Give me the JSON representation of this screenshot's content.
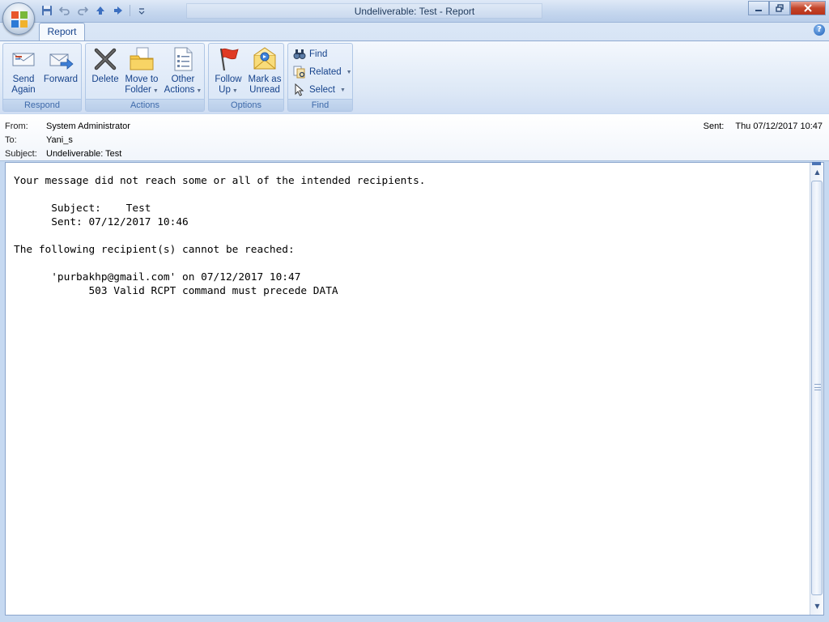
{
  "window": {
    "title": "Undeliverable: Test - Report"
  },
  "quick_access": {
    "icons": [
      "save-icon",
      "undo-icon",
      "redo-icon",
      "previous-item-icon",
      "next-item-icon",
      "customize-icon"
    ]
  },
  "ribbon": {
    "tab_label": "Report",
    "groups": {
      "respond": {
        "label": "Respond",
        "send_again": [
          "Send",
          "Again"
        ],
        "forward": [
          "Forward",
          ""
        ]
      },
      "actions": {
        "label": "Actions",
        "delete": [
          "Delete",
          ""
        ],
        "move_to_folder": [
          "Move to",
          "Folder"
        ],
        "other_actions": [
          "Other",
          "Actions"
        ]
      },
      "options": {
        "label": "Options",
        "follow_up": [
          "Follow",
          "Up"
        ],
        "mark_as_unread": [
          "Mark as",
          "Unread"
        ]
      },
      "find": {
        "label": "Find",
        "find": "Find",
        "related": "Related",
        "select": "Select"
      }
    }
  },
  "header": {
    "from_label": "From:",
    "from_value": "System Administrator",
    "to_label": "To:",
    "to_value": "Yani_s",
    "subject_label": "Subject:",
    "subject_value": "Undeliverable: Test",
    "sent_label": "Sent:",
    "sent_value": "Thu 07/12/2017 10:47"
  },
  "message": {
    "line1": "Your message did not reach some or all of the intended recipients.",
    "line2": "      Subject:    Test",
    "line3": "      Sent: 07/12/2017 10:46",
    "line4": "The following recipient(s) cannot be reached:",
    "line5": "      'purbakhp@gmail.com' on 07/12/2017 10:47",
    "line6": "            503 Valid RCPT command must precede DATA"
  },
  "colors": {
    "accent": "#15428b",
    "ribbon_bg": "#dbe7f6",
    "close_button": "#c3452a"
  }
}
